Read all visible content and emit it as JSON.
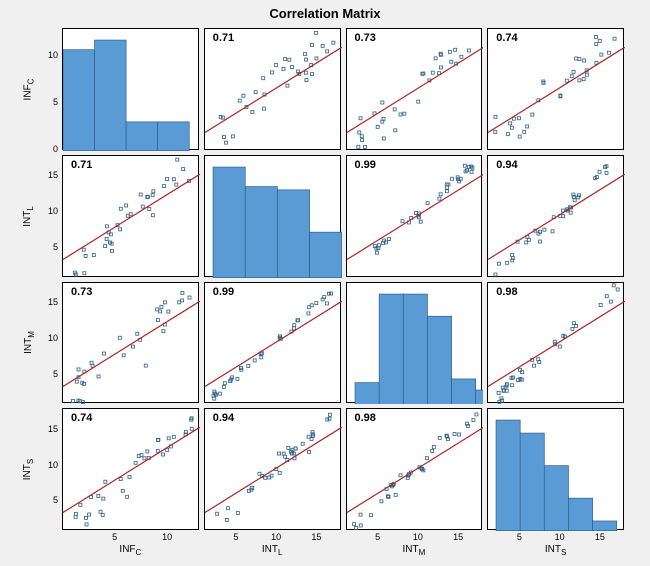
{
  "chart_data": {
    "type": "scatter-matrix",
    "title": "Correlation  Matrix",
    "variables": [
      {
        "name": "INF_C",
        "label_html": "INF<sub>C</sub>",
        "range": [
          0,
          13
        ],
        "ticks_x": [
          5,
          10
        ],
        "ticks_y": [
          0,
          5,
          10
        ]
      },
      {
        "name": "INT_L",
        "label_html": "INT<sub>L</sub>",
        "range": [
          1,
          18
        ],
        "ticks_x": [
          5,
          10,
          15
        ],
        "ticks_y": [
          5,
          10,
          15
        ]
      },
      {
        "name": "INT_M",
        "label_html": "INT<sub>M</sub>",
        "range": [
          1,
          18
        ],
        "ticks_x": [
          5,
          10,
          15
        ],
        "ticks_y": [
          5,
          10,
          15
        ]
      },
      {
        "name": "INT_S",
        "label_html": "INT<sub>S</sub>",
        "range": [
          1,
          18
        ],
        "ticks_x": [
          5,
          10,
          15
        ],
        "ticks_y": [
          5,
          10,
          15
        ]
      }
    ],
    "correlations": {
      "INF_C-INT_L": 0.71,
      "INF_C-INT_M": 0.73,
      "INF_C-INT_S": 0.74,
      "INT_L-INT_M": 0.99,
      "INT_L-INT_S": 0.94,
      "INT_M-INT_S": 0.98
    },
    "histograms": {
      "INF_C": {
        "bin_edges": [
          0,
          3,
          6,
          9,
          12
        ],
        "counts": [
          10.5,
          11.5,
          3,
          3
        ]
      },
      "INT_L": {
        "bin_edges": [
          2,
          6,
          10,
          14,
          18
        ],
        "counts": [
          17,
          14,
          13.5,
          7
        ]
      },
      "INT_M": {
        "bin_edges": [
          2,
          5,
          8,
          11,
          14,
          17,
          20
        ],
        "counts": [
          3,
          15,
          15,
          12,
          3.5,
          2
        ]
      },
      "INT_S": {
        "bin_edges": [
          2,
          5,
          8,
          11,
          14,
          17
        ],
        "counts": [
          17,
          15,
          10,
          5,
          1.5
        ]
      }
    },
    "colors": {
      "bar_fill": "#5b9bd5",
      "bar_stroke": "#2e5f8a",
      "fit_line": "#b22222",
      "point": "#2e5f8a"
    }
  }
}
